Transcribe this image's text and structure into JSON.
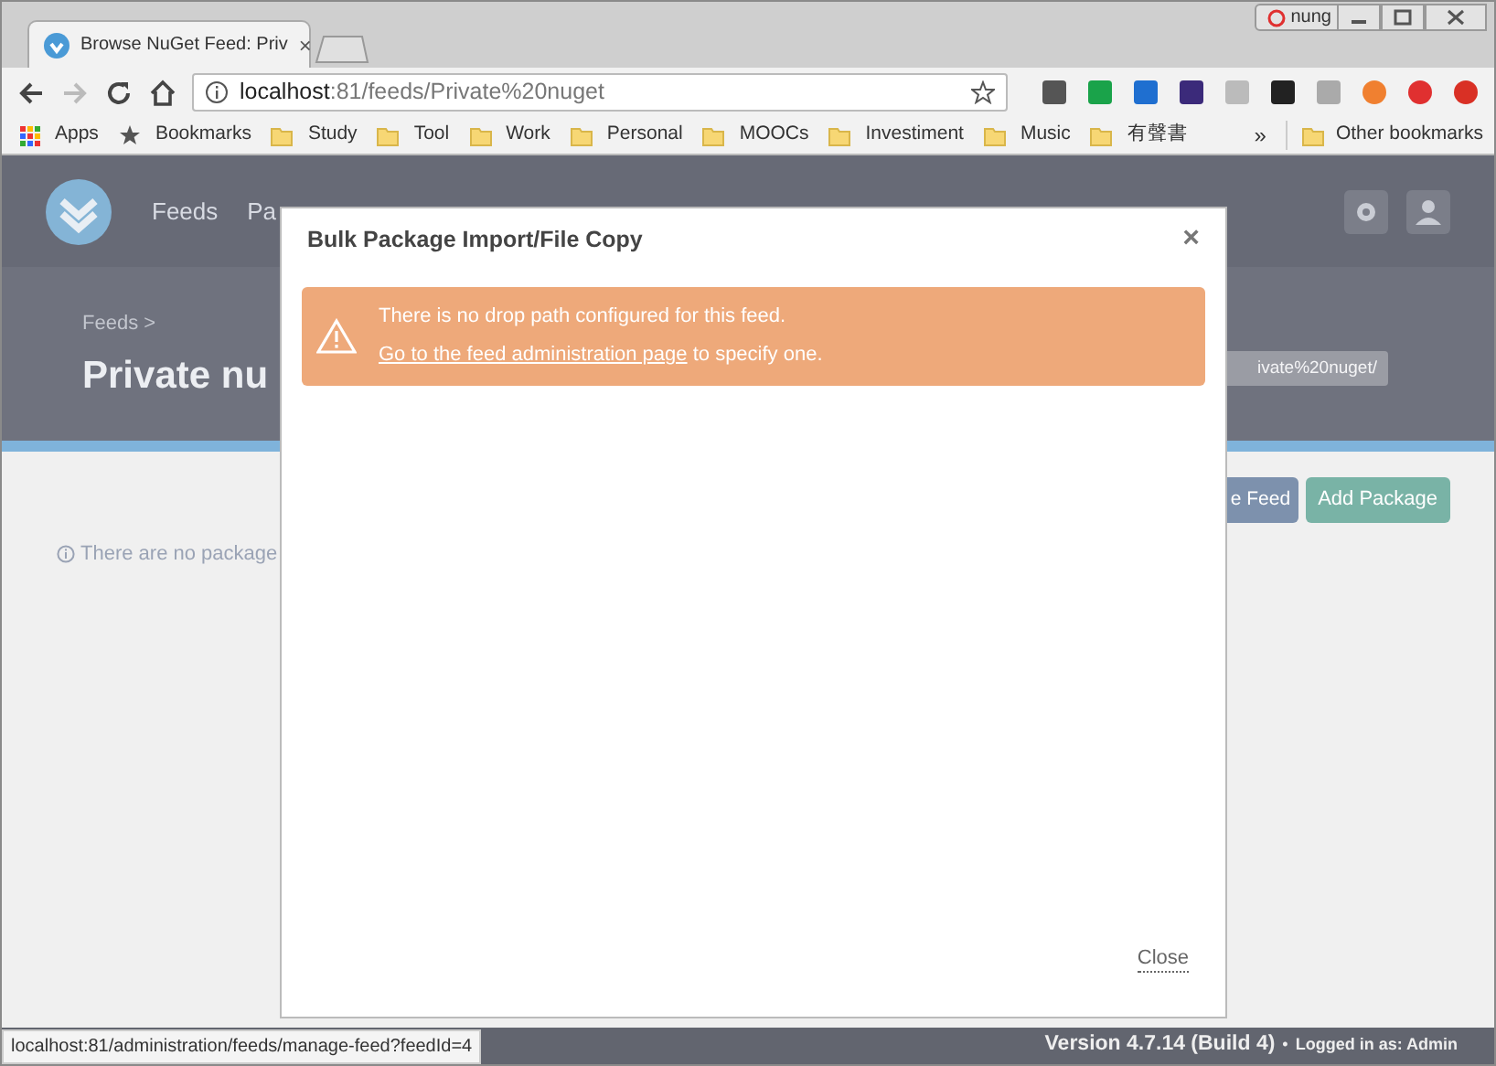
{
  "browser": {
    "tab_title": "Browse NuGet Feed: Priv",
    "tab_close": "×",
    "profile": "nung",
    "url_host": "localhost",
    "url_rest": ":81/feeds/Private%20nuget",
    "bookmarks": [
      {
        "label": "Apps",
        "kind": "apps"
      },
      {
        "label": "Bookmarks",
        "kind": "star"
      },
      {
        "label": "Study",
        "kind": "folder"
      },
      {
        "label": "Tool",
        "kind": "folder"
      },
      {
        "label": "Work",
        "kind": "folder"
      },
      {
        "label": "Personal",
        "kind": "folder"
      },
      {
        "label": "MOOCs",
        "kind": "folder"
      },
      {
        "label": "Investiment",
        "kind": "folder"
      },
      {
        "label": "Music",
        "kind": "folder"
      },
      {
        "label": "有聲書",
        "kind": "folder"
      }
    ],
    "overflow": "»",
    "other_bookmarks": "Other bookmarks"
  },
  "app": {
    "nav": [
      "Feeds",
      "Pa"
    ],
    "breadcrumb": "Feeds >",
    "title": "Private nu",
    "feed_url": "ivate%20nuget/",
    "manage_button": "e Feed",
    "add_button": "Add Package",
    "empty_message": "There are no package",
    "footer": {
      "version": "Version 4.7.14 (Build 4)",
      "separator": "•",
      "logged_in": "Logged in as: Admin"
    }
  },
  "modal": {
    "title": "Bulk Package Import/File Copy",
    "close_icon": "×",
    "alert_text": "There is no drop path configured for this feed.",
    "alert_link": "Go to the feed administration page",
    "alert_suffix": " to specify one.",
    "close_button": "Close"
  },
  "status_url": "localhost:81/administration/feeds/manage-feed?feedId=4"
}
